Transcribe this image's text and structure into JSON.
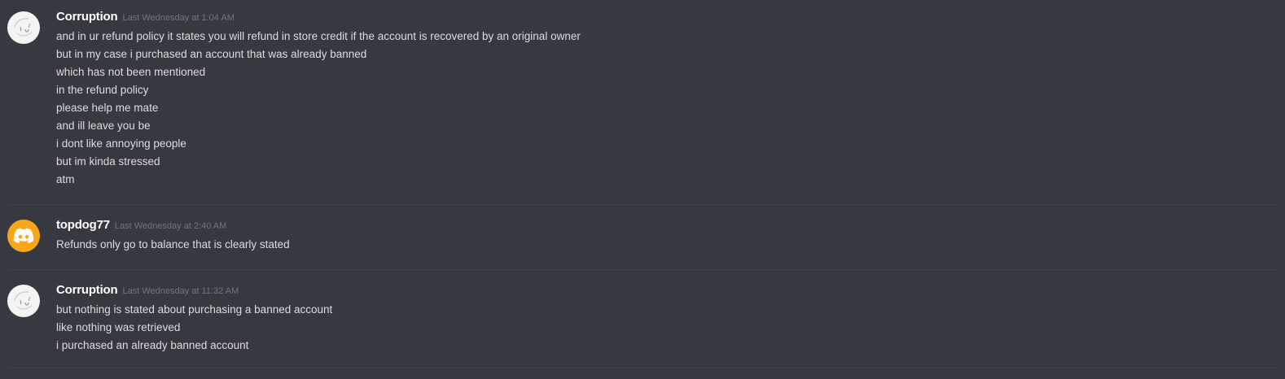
{
  "messages": [
    {
      "author": "Corruption",
      "avatar_icon": "sketch-face-avatar-icon",
      "timestamp": "Last Wednesday at 1:04 AM",
      "lines": [
        "and in ur refund policy it states you will refund in store credit if the account is recovered by an original owner",
        "but in my case i purchased an account that was already banned",
        "which has not been mentioned",
        "in the refund policy",
        "please help me mate",
        "and ill leave you be",
        "i dont like annoying people",
        "but im kinda stressed",
        "atm"
      ]
    },
    {
      "author": "topdog77",
      "avatar_icon": "discord-default-avatar-icon",
      "avatar_color": "#faa61a",
      "timestamp": "Last Wednesday at 2:40 AM",
      "lines": [
        "Refunds only go to balance that is clearly stated"
      ]
    },
    {
      "author": "Corruption",
      "avatar_icon": "sketch-face-avatar-icon",
      "timestamp": "Last Wednesday at 11:32 AM",
      "lines": [
        "but nothing is stated about purchasing a banned account",
        "like nothing was retrieved",
        "i purchased an already banned account"
      ]
    }
  ],
  "colors": {
    "background": "#36393f",
    "username": "#ffffff",
    "timestamp": "#72767d",
    "message_text": "#dcddde",
    "divider": "#40434a"
  }
}
